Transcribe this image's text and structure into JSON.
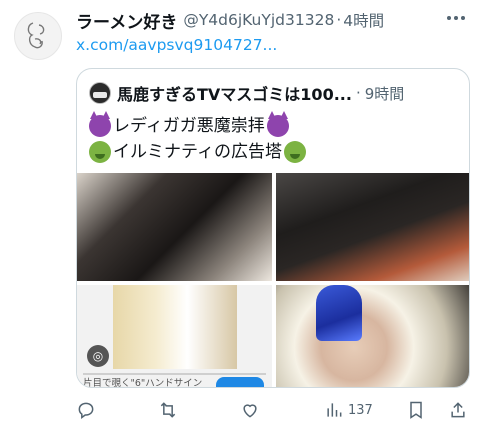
{
  "tweet": {
    "display_name": "ラーメン好き",
    "handle": "@Y4d6jKuYjd31328",
    "separator": "·",
    "time": "4時間",
    "link": "x.com/aavpsvq9104727...",
    "more_icon": "more-icon"
  },
  "quote": {
    "display_name": "馬鹿すぎるTVマスゴミは100...",
    "separator": "·",
    "time": "9時間",
    "line1": "レディガガ悪魔崇拝",
    "line2": "イルミナティの広告塔",
    "emoji_line1": "devil-emoji",
    "emoji_line2": "nauseated-emoji",
    "media_caption": "片目で覗く\"6\"ハンドサイン"
  },
  "actions": {
    "reply_icon": "reply-icon",
    "retweet_icon": "retweet-icon",
    "like_icon": "like-icon",
    "views_icon": "views-icon",
    "views_count": "137",
    "bookmark_icon": "bookmark-icon",
    "share_icon": "share-icon"
  },
  "colors": {
    "link": "#1d9bf0",
    "secondary_text": "#536471",
    "border": "#cfd9de"
  }
}
